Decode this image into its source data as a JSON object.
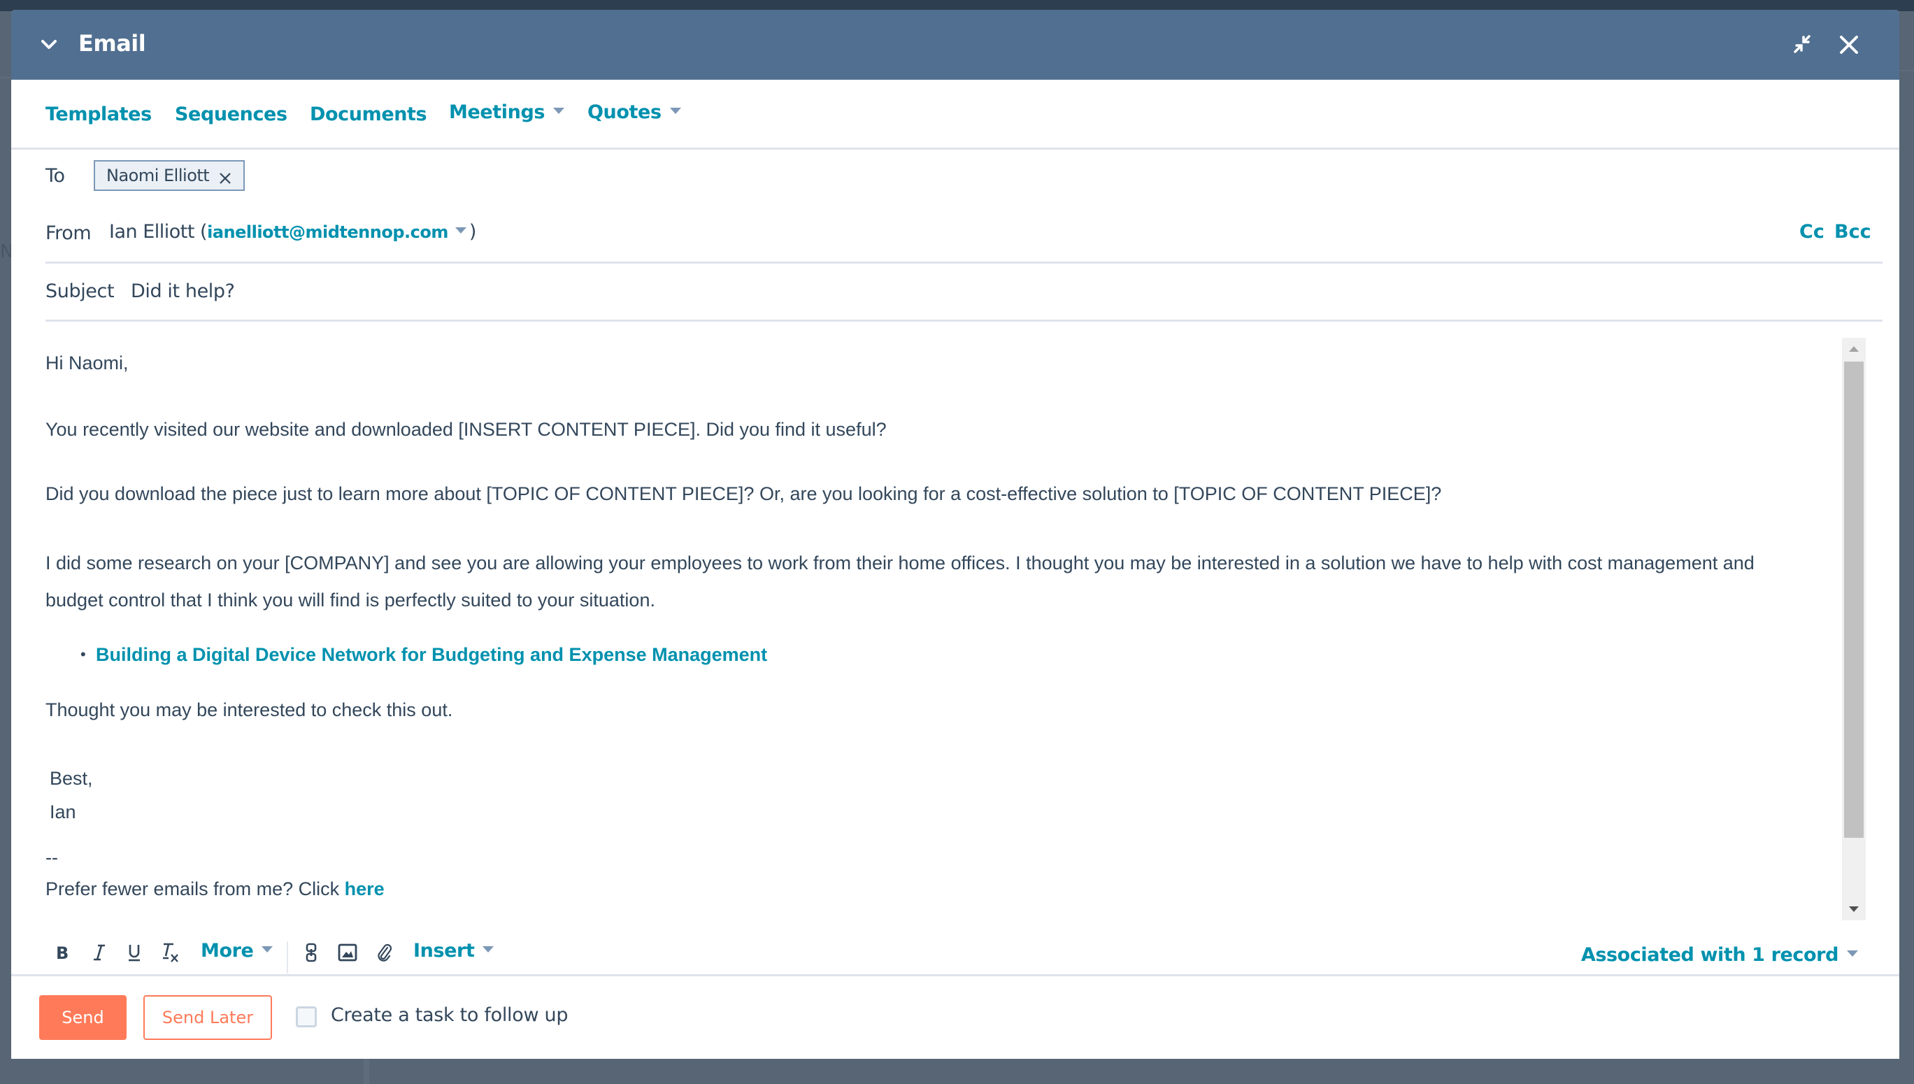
{
  "window": {
    "title": "Email",
    "icons": {
      "collapse": "chevron-down-icon",
      "minimize": "minimize-arrows-icon",
      "close": "close-icon"
    }
  },
  "nav": {
    "templates": "Templates",
    "sequences": "Sequences",
    "documents": "Documents",
    "meetings": "Meetings",
    "quotes": "Quotes"
  },
  "fields": {
    "to_label": "To",
    "to_recipients": [
      {
        "name": "Naomi Elliott"
      }
    ],
    "from_label": "From",
    "from_name": "Ian Elliott",
    "from_email": "ianelliott@midtennop.com",
    "cc_label": "Cc",
    "bcc_label": "Bcc",
    "subject_label": "Subject",
    "subject_value": "Did it help?"
  },
  "body": {
    "greeting": "Hi Naomi,",
    "para1": "You recently visited our website and downloaded [INSERT CONTENT PIECE]. Did you find it useful?",
    "para2": "Did you download the piece just to learn more about [TOPIC OF CONTENT PIECE]? Or, are you looking for a cost-effective solution to [TOPIC OF CONTENT PIECE]?",
    "para3_line1": "I did some research on your [COMPANY] and see you are allowing your employees to work from their home offices. I thought you may be interested in a solution we have to help with cost management and",
    "para3_line2": "budget control that I think you will find is perfectly suited to your situation.",
    "bullet_link": "Building a Digital Device Network for Budgeting and Expense Management",
    "para4": "Thought you may be interested to check this out.",
    "signoff": "Best,",
    "signature_name": "Ian",
    "sig_separator": "--",
    "unsubscribe_text": "Prefer fewer emails from me? Click ",
    "unsubscribe_link": "here"
  },
  "toolbar": {
    "bold": "bold-icon",
    "italic": "italic-icon",
    "underline": "underline-icon",
    "clear_format": "clear-formatting-icon",
    "more_label": "More",
    "link": "link-icon",
    "image": "image-icon",
    "attachment": "paperclip-icon",
    "insert_label": "Insert",
    "associated_label": "Associated with 1 record"
  },
  "footer": {
    "send_label": "Send",
    "send_later_label": "Send Later",
    "follow_up_label": "Create a task to follow up",
    "follow_up_checked": false
  },
  "colors": {
    "header_bg": "#516f90",
    "link": "#0091ae",
    "text": "#33475b",
    "primary_button": "#ff7a59",
    "overlay": "#576574"
  }
}
